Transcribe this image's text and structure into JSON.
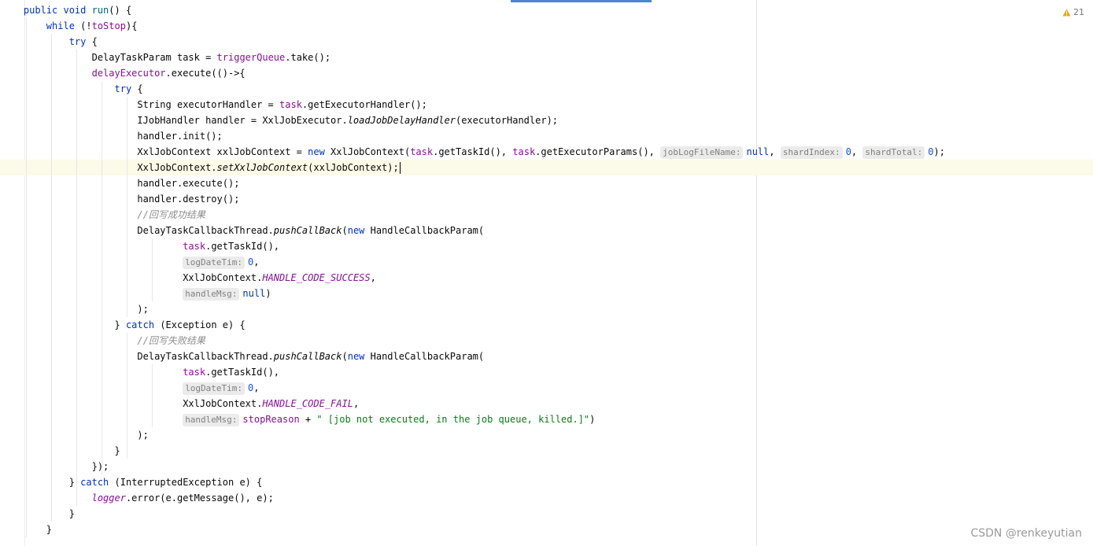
{
  "editor": {
    "warning_count": "21",
    "warning_icon": "warning-triangle-icon",
    "accent_color": "#4a87d6",
    "current_line": 10
  },
  "code": {
    "lines": [
      {
        "indent": "    ",
        "tokens": [
          {
            "t": "public void ",
            "c": "kw"
          },
          {
            "t": "run",
            "c": "mth"
          },
          {
            "t": "() {"
          }
        ]
      },
      {
        "indent": "        ",
        "tokens": [
          {
            "t": "while ",
            "c": "kw"
          },
          {
            "t": "(!"
          },
          {
            "t": "toStop",
            "c": "fld"
          },
          {
            "t": "){"
          }
        ]
      },
      {
        "indent": "            ",
        "tokens": [
          {
            "t": "try ",
            "c": "kw"
          },
          {
            "t": "{"
          }
        ]
      },
      {
        "indent": "                ",
        "tokens": [
          {
            "t": "DelayTaskParam task = "
          },
          {
            "t": "triggerQueue",
            "c": "fld"
          },
          {
            "t": ".take();"
          }
        ]
      },
      {
        "indent": "                ",
        "tokens": [
          {
            "t": "delayExecutor",
            "c": "fld"
          },
          {
            "t": ".execute(()->{"
          }
        ]
      },
      {
        "indent": "                    ",
        "tokens": [
          {
            "t": "try ",
            "c": "kw"
          },
          {
            "t": "{"
          }
        ]
      },
      {
        "indent": "                        ",
        "tokens": [
          {
            "t": "String executorHandler = "
          },
          {
            "t": "task",
            "c": "fld"
          },
          {
            "t": ".getExecutorHandler();"
          }
        ]
      },
      {
        "indent": "                        ",
        "tokens": [
          {
            "t": "IJobHandler handler = XxlJobExecutor."
          },
          {
            "t": "loadJobDelayHandler",
            "c": "smth"
          },
          {
            "t": "(executorHandler);"
          }
        ]
      },
      {
        "indent": "                        ",
        "tokens": [
          {
            "t": "handler.init();"
          }
        ]
      },
      {
        "indent": "                        ",
        "tokens": [
          {
            "t": "XxlJobContext xxlJobContext = "
          },
          {
            "t": "new ",
            "c": "kw"
          },
          {
            "t": "XxlJobContext("
          },
          {
            "t": "task",
            "c": "fld"
          },
          {
            "t": ".getTaskId(), "
          },
          {
            "t": "task",
            "c": "fld"
          },
          {
            "t": ".getExecutorParams(), "
          },
          {
            "t": "jobLogFileName:",
            "c": "hint"
          },
          {
            "t": "null",
            "c": "kw"
          },
          {
            "t": ", "
          },
          {
            "t": "shardIndex:",
            "c": "hint"
          },
          {
            "t": "0",
            "c": "num"
          },
          {
            "t": ", "
          },
          {
            "t": "shardTotal:",
            "c": "hint"
          },
          {
            "t": "0",
            "c": "num"
          },
          {
            "t": ");"
          }
        ]
      },
      {
        "indent": "                        ",
        "tokens": [
          {
            "t": "XxlJobContext."
          },
          {
            "t": "setXxlJobContext",
            "c": "smth"
          },
          {
            "t": "(xxlJobContext);"
          },
          {
            "t": "",
            "c": "caret"
          }
        ]
      },
      {
        "indent": "                        ",
        "tokens": [
          {
            "t": "handler.execute();"
          }
        ]
      },
      {
        "indent": "                        ",
        "tokens": [
          {
            "t": "handler.destroy();"
          }
        ]
      },
      {
        "indent": "                        ",
        "tokens": [
          {
            "t": "//回写成功结果",
            "c": "cmt"
          }
        ]
      },
      {
        "indent": "                        ",
        "tokens": [
          {
            "t": "DelayTaskCallbackThread."
          },
          {
            "t": "pushCallBack",
            "c": "smth"
          },
          {
            "t": "("
          },
          {
            "t": "new ",
            "c": "kw"
          },
          {
            "t": "HandleCallbackParam("
          }
        ]
      },
      {
        "indent": "                                ",
        "tokens": [
          {
            "t": "task",
            "c": "fld"
          },
          {
            "t": ".getTaskId(),"
          }
        ]
      },
      {
        "indent": "                                ",
        "tokens": [
          {
            "t": "logDateTim:",
            "c": "hint"
          },
          {
            "t": "0",
            "c": "num"
          },
          {
            "t": ","
          }
        ]
      },
      {
        "indent": "                                ",
        "tokens": [
          {
            "t": "XxlJobContext."
          },
          {
            "t": "HANDLE_CODE_SUCCESS",
            "c": "sfld"
          },
          {
            "t": ","
          }
        ]
      },
      {
        "indent": "                                ",
        "tokens": [
          {
            "t": "handleMsg:",
            "c": "hint"
          },
          {
            "t": "null",
            "c": "kw"
          },
          {
            "t": ")"
          }
        ]
      },
      {
        "indent": "                        ",
        "tokens": [
          {
            "t": ");"
          }
        ]
      },
      {
        "indent": "                    ",
        "tokens": [
          {
            "t": "} "
          },
          {
            "t": "catch ",
            "c": "kw"
          },
          {
            "t": "(Exception e) {"
          }
        ]
      },
      {
        "indent": "                        ",
        "tokens": [
          {
            "t": "//回写失败结果",
            "c": "cmt"
          }
        ]
      },
      {
        "indent": "                        ",
        "tokens": [
          {
            "t": "DelayTaskCallbackThread."
          },
          {
            "t": "pushCallBack",
            "c": "smth"
          },
          {
            "t": "("
          },
          {
            "t": "new ",
            "c": "kw"
          },
          {
            "t": "HandleCallbackParam("
          }
        ]
      },
      {
        "indent": "                                ",
        "tokens": [
          {
            "t": "task",
            "c": "fld"
          },
          {
            "t": ".getTaskId(),"
          }
        ]
      },
      {
        "indent": "                                ",
        "tokens": [
          {
            "t": "logDateTim:",
            "c": "hint"
          },
          {
            "t": "0",
            "c": "num"
          },
          {
            "t": ","
          }
        ]
      },
      {
        "indent": "                                ",
        "tokens": [
          {
            "t": "XxlJobContext."
          },
          {
            "t": "HANDLE_CODE_FAIL",
            "c": "sfld"
          },
          {
            "t": ","
          }
        ]
      },
      {
        "indent": "                                ",
        "tokens": [
          {
            "t": "handleMsg:",
            "c": "hint"
          },
          {
            "t": "stopReason",
            "c": "fld"
          },
          {
            "t": " + "
          },
          {
            "t": "\" [job not executed, in the job queue, killed.]\"",
            "c": "str"
          },
          {
            "t": ")"
          }
        ]
      },
      {
        "indent": "                        ",
        "tokens": [
          {
            "t": ");"
          }
        ]
      },
      {
        "indent": "                    ",
        "tokens": [
          {
            "t": "}"
          }
        ]
      },
      {
        "indent": "                ",
        "tokens": [
          {
            "t": "});"
          }
        ]
      },
      {
        "indent": "            ",
        "tokens": [
          {
            "t": "} "
          },
          {
            "t": "catch ",
            "c": "kw"
          },
          {
            "t": "(InterruptedException e) {"
          }
        ]
      },
      {
        "indent": "                ",
        "tokens": [
          {
            "t": "logger",
            "c": "sfld"
          },
          {
            "t": ".error(e.getMessage(), e);"
          }
        ]
      },
      {
        "indent": "            ",
        "tokens": [
          {
            "t": "}"
          }
        ]
      },
      {
        "indent": "        ",
        "tokens": [
          {
            "t": "}"
          }
        ]
      }
    ]
  },
  "watermark": "CSDN @renkeyutian"
}
